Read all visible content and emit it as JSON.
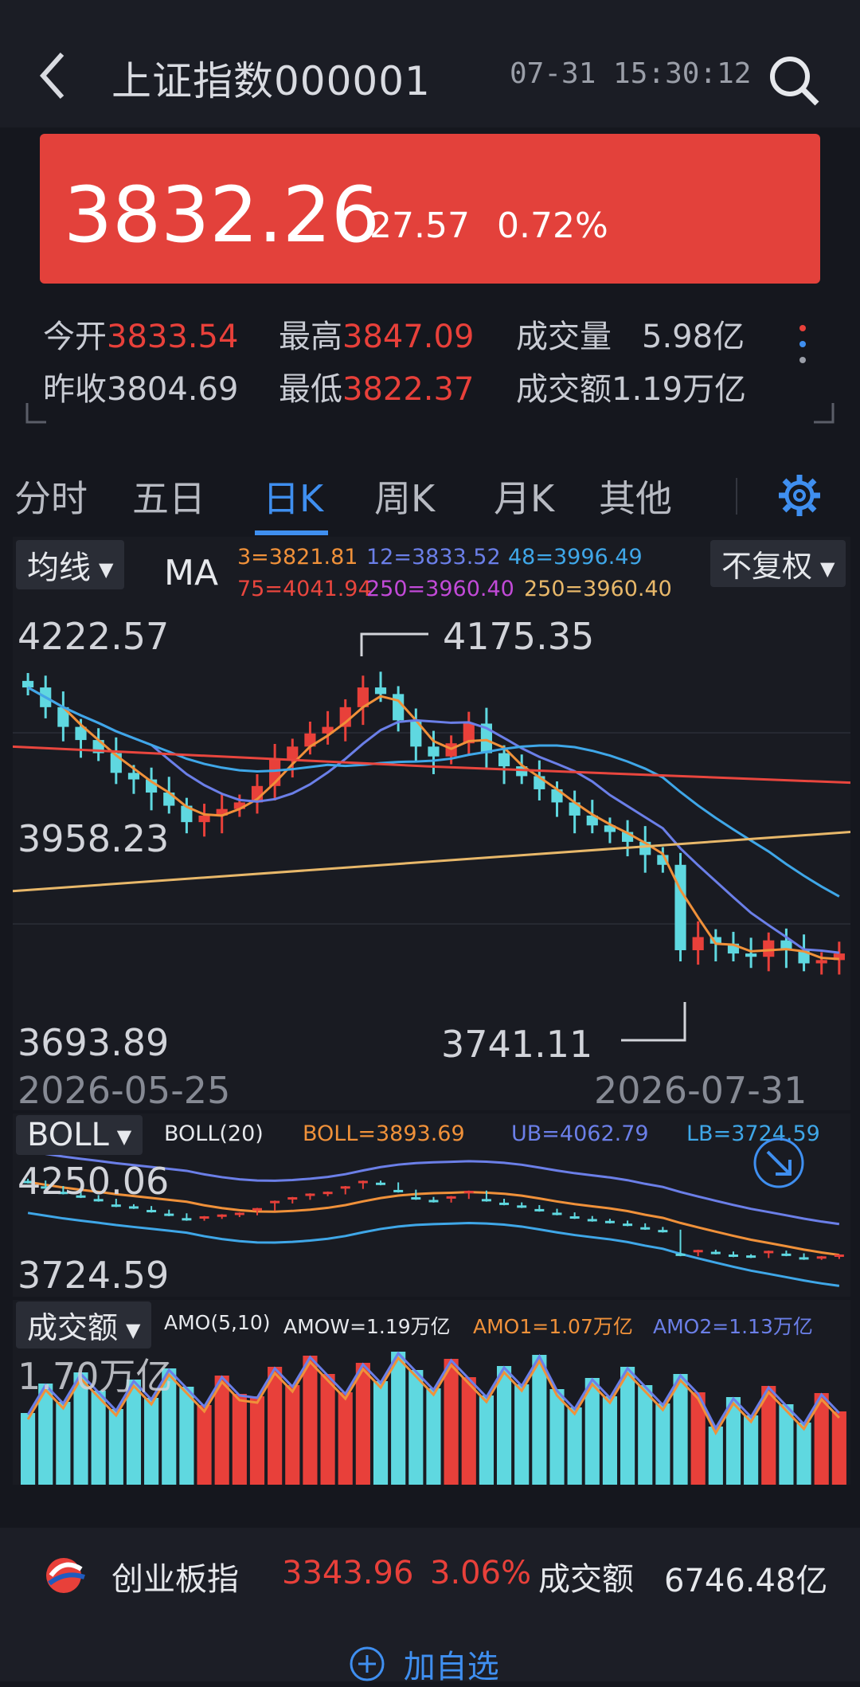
{
  "header": {
    "title": "上证指数000001",
    "datetime": "07-31 15:30:12"
  },
  "quote": {
    "price": "3832.26",
    "change": "27.57",
    "change_pct": "0.72%",
    "stats": [
      {
        "label": "今开",
        "value": "3833.54"
      },
      {
        "label": "最高",
        "value": "3847.09"
      },
      {
        "label": "成交量",
        "value": "5.98亿"
      },
      {
        "label": "昨收",
        "value": "3804.69"
      },
      {
        "label": "最低",
        "value": "3822.37"
      },
      {
        "label": "成交额",
        "value": "1.19万亿"
      }
    ]
  },
  "tabs": [
    {
      "label": "分时"
    },
    {
      "label": "五日"
    },
    {
      "label": "日K",
      "active": true
    },
    {
      "label": "周K"
    },
    {
      "label": "月K"
    },
    {
      "label": "其他"
    }
  ],
  "kline": {
    "indicator_dropdown": "均线",
    "ma_label": "MA",
    "ma_values": [
      {
        "text": "3=3821.81",
        "color": "#f0913a"
      },
      {
        "text": "12=3833.52",
        "color": "#6b7fe8"
      },
      {
        "text": "48=3996.49",
        "color": "#3fa7e8"
      },
      {
        "text": "75=4041.94",
        "color": "#e9463e"
      },
      {
        "text": "250=3960.40",
        "color": "#c24ad8"
      },
      {
        "text": "250=3960.40",
        "color": "#e8b86a"
      }
    ],
    "adjust_dropdown": "不复权",
    "y_labels": [
      "4222.57",
      "3958.23",
      "3693.89"
    ],
    "high_marker": "4175.35",
    "low_marker": "3741.11",
    "dates": [
      "2026-05-25",
      "2026-07-31"
    ]
  },
  "boll": {
    "dropdown": "BOLL",
    "param": "BOLL(20)",
    "boll": "BOLL=3893.69",
    "ub": "UB=4062.79",
    "lb": "LB=3724.59",
    "y_labels": [
      "4250.06",
      "3724.59"
    ]
  },
  "volume": {
    "dropdown": "成交额",
    "param": "AMO(5,10)",
    "amow": "AMOW=1.19万亿",
    "amo1": "AMO1=1.07万亿",
    "amo2": "AMO2=1.13万亿",
    "y_label": "1.70万亿"
  },
  "footer": {
    "name": "创业板指",
    "price": "3343.96",
    "pct": "3.06%",
    "amount_label": "成交额",
    "amount": "6746.48亿",
    "add_label": "加自选"
  },
  "colors": {
    "up": "#e8403a",
    "down": "#5fd8e0",
    "accent": "#3f8ff0"
  },
  "chart_data": {
    "type": "candlestick",
    "close": [
      4180,
      4150,
      4120,
      4100,
      4080,
      4050,
      4040,
      4020,
      4000,
      3975,
      3985,
      3995,
      4005,
      4030,
      4070,
      4090,
      4110,
      4120,
      4150,
      4180,
      4170,
      4130,
      4090,
      4075,
      4095,
      4125,
      4080,
      4060,
      4045,
      4025,
      4005,
      3985,
      3970,
      3960,
      3945,
      3925,
      3910,
      3780,
      3800,
      3790,
      3775,
      3770,
      3795,
      3780,
      3760,
      3765,
      3775
    ],
    "boll_y_range": [
      "3724.59",
      "4250.06"
    ]
  }
}
